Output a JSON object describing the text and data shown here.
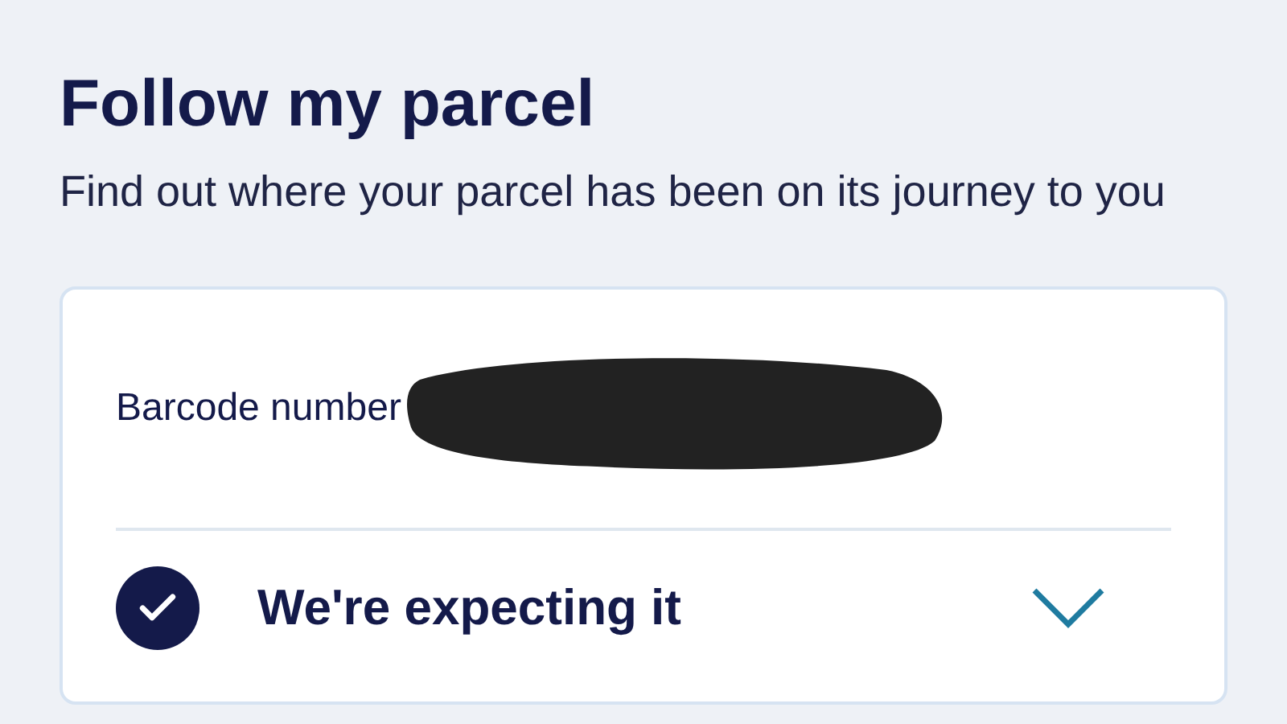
{
  "title": "Follow my parcel",
  "subtitle": "Find out where your parcel has been on its journey to you",
  "card": {
    "barcode_label": "Barcode number",
    "status": {
      "label": "We're expecting it",
      "checked": true,
      "expanded": false
    }
  }
}
